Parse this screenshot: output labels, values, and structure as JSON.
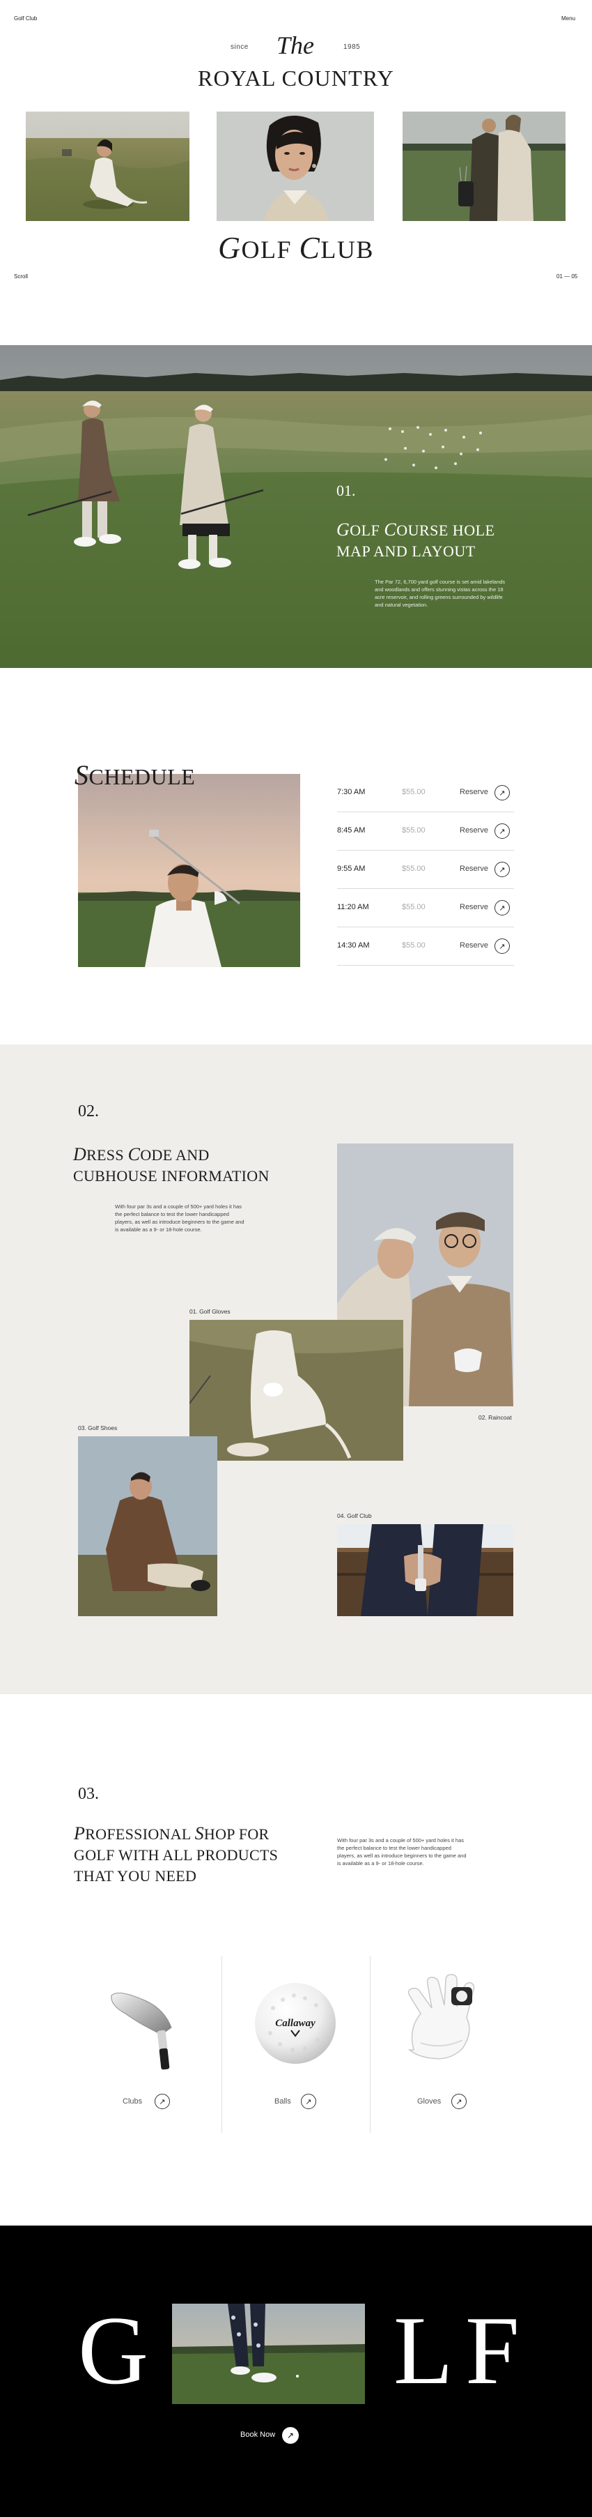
{
  "header": {
    "brand": "Golf Club",
    "menu": "Menu",
    "since": "since",
    "the": "The",
    "year": "1985",
    "title": "ROYAL COUNTRY",
    "subtitle_cap1": "G",
    "subtitle_rest1": "OLF ",
    "subtitle_cap2": "C",
    "subtitle_rest2": "LUB",
    "scroll": "Scroll",
    "counter": "01 — 05"
  },
  "course": {
    "number": "01.",
    "title_line1_cap1": "G",
    "title_line1_rest1": "OLF ",
    "title_line1_cap2": "C",
    "title_line1_rest2": "OURSE HOLE",
    "title_line2": "MAP AND LAYOUT",
    "description": "The Par 72, 6,700 yard golf course is set amid lakelands and woodlands and offers stunning vistas across the 18 acre reservoir, and rolling greens surrounded by wildlife and natural vegetation."
  },
  "schedule": {
    "title_cap": "S",
    "title_rest": "CHEDULE",
    "rows": [
      {
        "time": "7:30 AM",
        "price": "$55.00",
        "action": "Reserve"
      },
      {
        "time": "8:45 AM",
        "price": "$55.00",
        "action": "Reserve"
      },
      {
        "time": "9:55 AM",
        "price": "$55.00",
        "action": "Reserve"
      },
      {
        "time": "11:20 AM",
        "price": "$55.00",
        "action": "Reserve"
      },
      {
        "time": "14:30 AM",
        "price": "$55.00",
        "action": "Reserve"
      }
    ]
  },
  "dress": {
    "number": "02.",
    "title_line1_cap1": "D",
    "title_line1_rest1": "RESS ",
    "title_line1_cap2": "C",
    "title_line1_rest2": "ODE AND",
    "title_line2": "CUBHOUSE INFORMATION",
    "description": "With four par 3s and a couple of 500+ yard holes it has the perfect balance to test the lower handicapped players, as well as introduce beginners to the game and is available as a 9- or 18-hole course.",
    "captions": {
      "gloves": "01. Golf Gloves",
      "raincoat": "02. Raincoat",
      "shoes": "03. Golf Shoes",
      "club": "04. Golf Club"
    }
  },
  "shop": {
    "number": "03.",
    "title_line1_cap1": "P",
    "title_line1_rest1": "ROFESSIONAL ",
    "title_line1_cap2": "S",
    "title_line1_rest2": "HOP FOR",
    "title_line2": "GOLF WITH ALL PRODUCTS",
    "title_line3": "THAT YOU NEED",
    "description": "With four par 3s and a couple of 500+ yard holes it has the perfect balance to test the lower handicapped players, as well as introduce beginners to the game and is available as a 9- or 18-hole course.",
    "products": [
      {
        "label": "Clubs",
        "icon": "golf-club-icon"
      },
      {
        "label": "Balls",
        "icon": "golf-ball-icon"
      },
      {
        "label": "Gloves",
        "icon": "golf-glove-icon"
      }
    ],
    "ball_brand": "Callaway"
  },
  "footer": {
    "letter_g": "G",
    "letter_l": "L",
    "letter_f": "F",
    "book": "Book Now"
  },
  "colors": {
    "ink": "#1e1e1e",
    "dress_bg": "#efeeeb",
    "footer_bg": "#000000",
    "grass": "#5d7a3e"
  }
}
